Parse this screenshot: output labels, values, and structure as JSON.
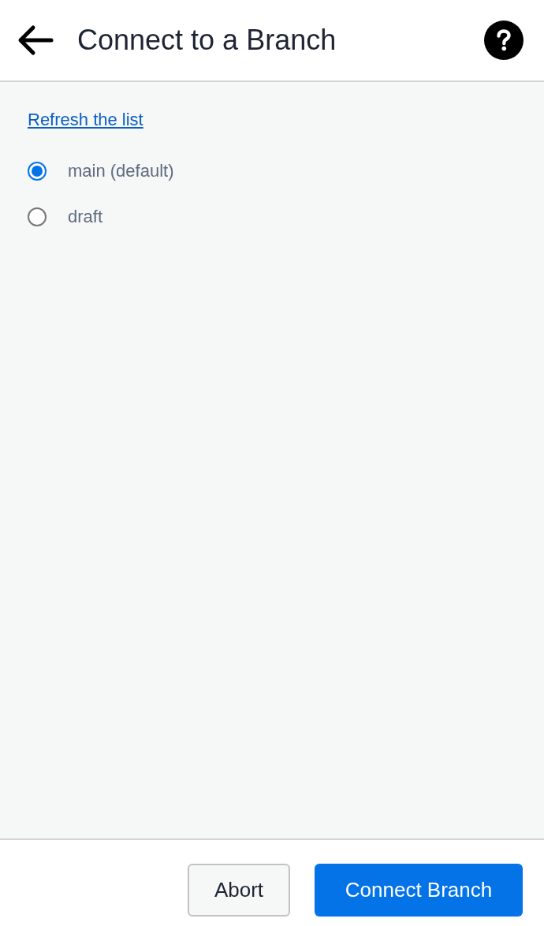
{
  "header": {
    "title": "Connect to a Branch"
  },
  "refresh_link": "Refresh the list",
  "branches": [
    {
      "label": "main (default)",
      "selected": true
    },
    {
      "label": "draft",
      "selected": false
    }
  ],
  "buttons": [
    {
      "label": "Abort",
      "kind": "secondary"
    },
    {
      "label": "Connect Branch",
      "kind": "primary"
    }
  ]
}
